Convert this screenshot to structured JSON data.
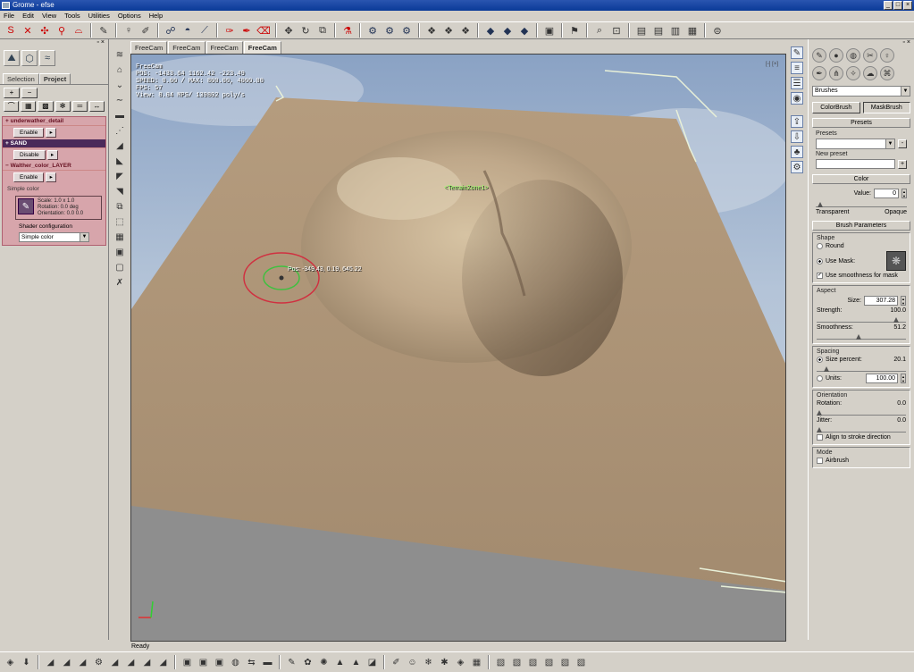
{
  "window": {
    "title": "Grome - efse"
  },
  "menu": [
    "File",
    "Edit",
    "View",
    "Tools",
    "Utilities",
    "Options",
    "Help"
  ],
  "left_panel": {
    "tabs": [
      "Selection",
      "Project"
    ],
    "layers": [
      {
        "name": "underwather_detail",
        "button": "Enable"
      },
      {
        "name": "SAND",
        "button": "Disable"
      },
      {
        "name": "Walther_color_LAYER",
        "button": "Enable"
      }
    ],
    "simple_color_label": "Simple color",
    "material": {
      "scale": "Scale: 1.0 x 1.0",
      "rotation": "Rotation: 0.0 deg",
      "orientation": "Orientation: 0.0 0.0"
    },
    "shader_config_label": "Shader configuration",
    "shader_value": "Simple color"
  },
  "viewport": {
    "tabs": [
      "FreeCam",
      "FreeCam",
      "FreeCam",
      "FreeCam"
    ],
    "hud": [
      "FreeCam",
      "POS: -1433.64 1162.42 -223.49",
      "SPEED: 0.00 / MAX: 800.00, 4000.00",
      "FPS: 57",
      "View: 8.04 MPS/ 139802 poly/s"
    ],
    "zone_label": "TerrainZone1",
    "pos_label": "Pos: -349.43, 0.19, 645.22"
  },
  "right_panel": {
    "mode_select": "Brushes",
    "brush_buttons": [
      "ColorBrush",
      "MaskBrush"
    ],
    "presets_header": "Presets",
    "presets_label": "Presets",
    "new_preset_label": "New preset",
    "color_header": "Color",
    "value_label": "Value:",
    "value": "0",
    "transparent_label": "Transparent",
    "opaque_label": "Opaque",
    "brush_params_header": "Brush Parameters",
    "shape_label": "Shape",
    "round_label": "Round",
    "use_mask_label": "Use Mask:",
    "smoothness_mask_label": "Use smoothness for mask",
    "aspect_label": "Aspect",
    "size_label": "Size:",
    "size_value": "307.28",
    "strength_label": "Strength:",
    "strength_value": "100.0",
    "smoothness_label": "Smoothness:",
    "smoothness_value": "51.2",
    "spacing_label": "Spacing",
    "size_percent_label": "Size percent:",
    "size_percent_value": "20.1",
    "units_label": "Units:",
    "units_value": "100.00",
    "orientation_label": "Orientation",
    "rotation_label": "Rotation:",
    "rotation_value": "0.0",
    "jitter_label": "Jitter:",
    "jitter_value": "0.0",
    "align_label": "Align to stroke direction",
    "mode_label": "Mode",
    "airbrush_label": "Airbrush"
  },
  "status": {
    "text": "Ready"
  }
}
